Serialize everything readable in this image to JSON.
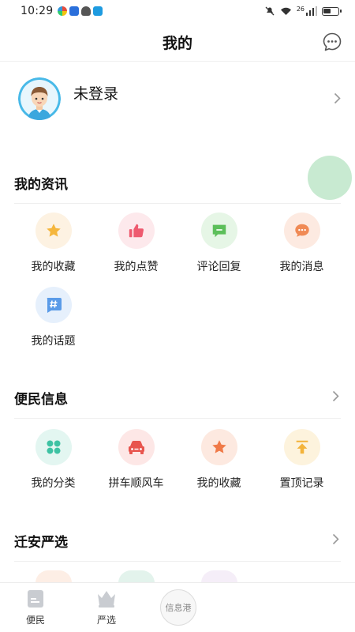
{
  "status_bar": {
    "time": "10:29",
    "network": "26"
  },
  "header": {
    "title": "我的",
    "message_icon": "chat-bubble-icon"
  },
  "profile": {
    "login_text": "未登录",
    "avatar_icon": "avatar-boy-icon"
  },
  "sections": [
    {
      "title": "我的资讯",
      "has_chevron": false,
      "items": [
        {
          "label": "我的收藏",
          "icon": "star-icon",
          "color": "#f5b63c",
          "bg": "#fdf2e2"
        },
        {
          "label": "我的点赞",
          "icon": "thumbs-up-icon",
          "color": "#ee5a6f",
          "bg": "#fde9ec"
        },
        {
          "label": "评论回复",
          "icon": "comment-icon",
          "color": "#5cbf5a",
          "bg": "#e6f6e6"
        },
        {
          "label": "我的消息",
          "icon": "message-icon",
          "color": "#f08a55",
          "bg": "#fdeae1"
        },
        {
          "label": "我的话题",
          "icon": "hashtag-icon",
          "color": "#5a9be8",
          "bg": "#e6f0fc"
        }
      ]
    },
    {
      "title": "便民信息",
      "has_chevron": true,
      "items": [
        {
          "label": "我的分类",
          "icon": "category-icon",
          "color": "#3dc2a3",
          "bg": "#e3f6f1"
        },
        {
          "label": "拼车顺风车",
          "icon": "car-icon",
          "color": "#e8554e",
          "bg": "#fde7e6"
        },
        {
          "label": "我的收藏",
          "icon": "star-icon",
          "color": "#f07a48",
          "bg": "#fde9e0"
        },
        {
          "label": "置顶记录",
          "icon": "pin-top-icon",
          "color": "#f3b33a",
          "bg": "#fdf3dd"
        }
      ]
    },
    {
      "title": "迁安严选",
      "has_chevron": true,
      "items": []
    }
  ],
  "bottom_nav": [
    {
      "label": "便民",
      "icon": "document-icon"
    },
    {
      "label": "严选",
      "icon": "crown-basket-icon"
    },
    {
      "label": "信息港",
      "icon": "info-port-icon"
    }
  ],
  "colors": {
    "accent_green": "#c8ead1",
    "divider": "#efefef"
  }
}
